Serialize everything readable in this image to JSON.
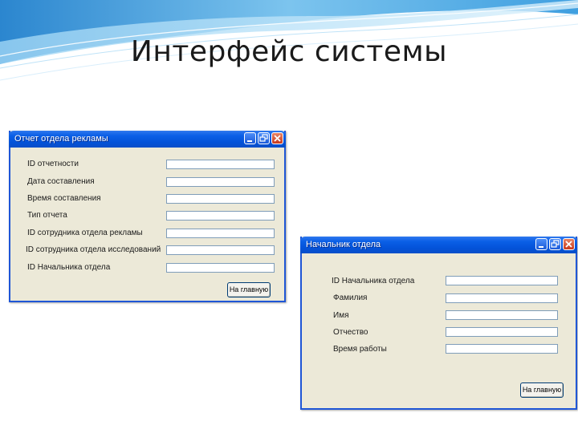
{
  "slide": {
    "title": "Интерфейс системы"
  },
  "window1": {
    "title": "Отчет отдела рекламы",
    "fields": [
      {
        "label": "ID отчетности"
      },
      {
        "label": "Дата составления"
      },
      {
        "label": "Время составления"
      },
      {
        "label": "Тип отчета"
      },
      {
        "label": "ID сотрудника отдела рекламы"
      },
      {
        "label": "ID сотрудника отдела исследований"
      },
      {
        "label": "ID Начальника отдела"
      }
    ],
    "button_label": "На главную"
  },
  "window2": {
    "title": "Начальник отдела",
    "fields": [
      {
        "label": "ID Начальника отдела"
      },
      {
        "label": "Фамилия"
      },
      {
        "label": "Имя"
      },
      {
        "label": "Отчество"
      },
      {
        "label": "Время работы"
      }
    ],
    "button_label": "На главную"
  },
  "colors": {
    "titlebar": "#0352d8",
    "window_body": "#ece9d8",
    "banner_blue": "#3a9ad9"
  }
}
